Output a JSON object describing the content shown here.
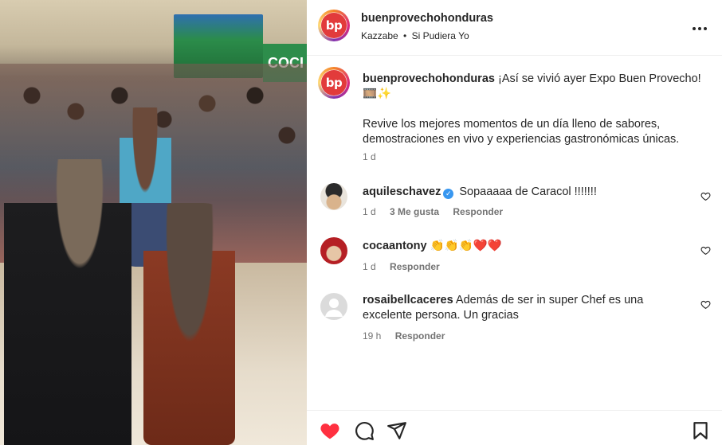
{
  "header": {
    "logo_text": "bp",
    "username": "buenprovechohonduras",
    "music_artist": "Kazzabe",
    "music_separator": "•",
    "music_title": "Si Pudiera Yo",
    "more_icon": "more-horizontal-icon"
  },
  "media": {
    "booth_sign": "COCI"
  },
  "caption": {
    "username": "buenprovechohonduras",
    "text": "¡Así se vivió ayer Expo Buen Provecho! 🎞️✨",
    "body": "Revive los mejores momentos de un día lleno de sabores, demostraciones en vivo y experiencias gastronómicas únicas.",
    "time": "1 d"
  },
  "comments": [
    {
      "username": "aquileschavez",
      "verified": true,
      "text": "Sopaaaaa de Caracol !!!!!!!",
      "time": "1 d",
      "likes": "3 Me gusta",
      "reply": "Responder"
    },
    {
      "username": "cocaantony",
      "verified": false,
      "text": "👏👏👏❤️❤️",
      "time": "1 d",
      "likes": "",
      "reply": "Responder"
    },
    {
      "username": "rosaibellcaceres",
      "verified": false,
      "text": "Además de ser in super Chef es una excelente persona. Un gracias",
      "time": "19 h",
      "likes": "",
      "reply": "Responder"
    }
  ],
  "actions": {
    "like_icon": "heart-filled-icon",
    "comment_icon": "comment-icon",
    "share_icon": "send-icon",
    "save_icon": "bookmark-icon",
    "like_color": "#ff3040"
  }
}
